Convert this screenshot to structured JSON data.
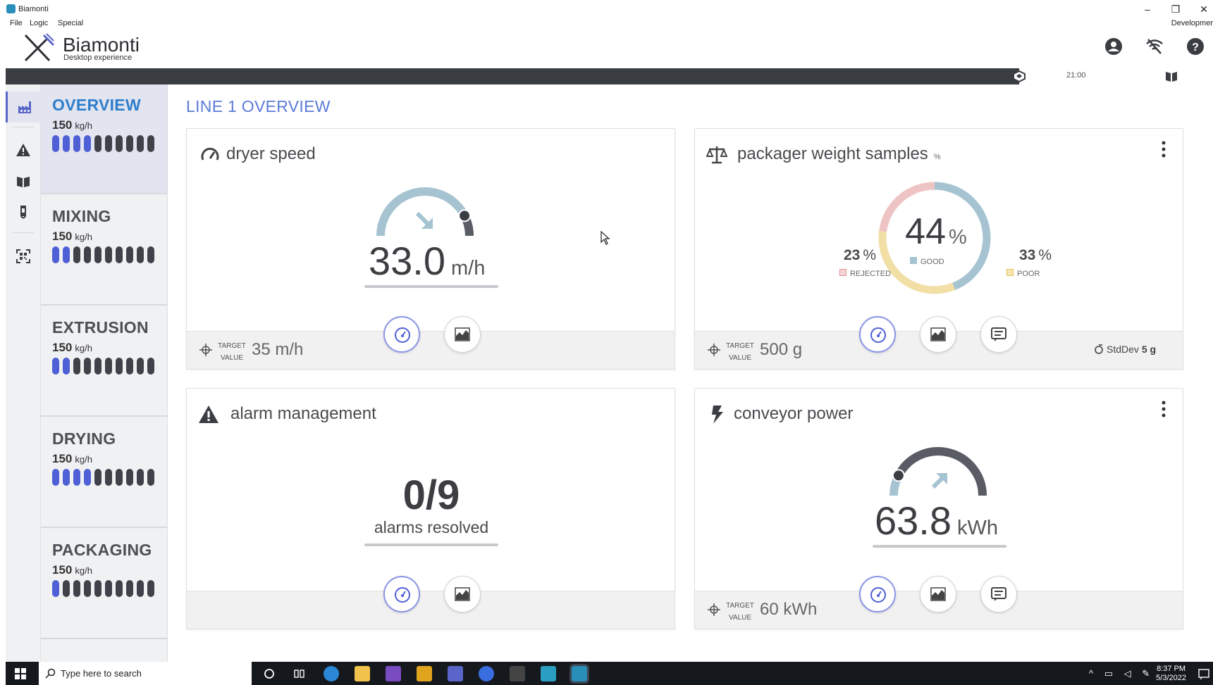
{
  "window": {
    "title": "Biamonti",
    "minimize": "–",
    "restore": "❐",
    "close": "✕"
  },
  "menu": {
    "items": [
      "File",
      "Logic",
      "Special"
    ],
    "right": "Developmer"
  },
  "brand": {
    "name": "Biamonti",
    "subtitle": "Desktop experience"
  },
  "header_icons": [
    "account-icon",
    "wifi-off-icon",
    "help-icon"
  ],
  "timeline": {
    "time": "21:00"
  },
  "rail_icons": [
    "factory-icon",
    "alert-icon",
    "map-book-icon",
    "test-tube-icon",
    "qr-scan-icon"
  ],
  "sections": [
    {
      "name": "OVERVIEW",
      "value": "150",
      "unit": "kg/h",
      "active_bars": 4,
      "total_bars": 10
    },
    {
      "name": "MIXING",
      "value": "150",
      "unit": "kg/h",
      "active_bars": 2,
      "total_bars": 10
    },
    {
      "name": "EXTRUSION",
      "value": "150",
      "unit": "kg/h",
      "active_bars": 2,
      "total_bars": 10
    },
    {
      "name": "DRYING",
      "value": "150",
      "unit": "kg/h",
      "active_bars": 4,
      "total_bars": 10
    },
    {
      "name": "PACKAGING",
      "value": "150",
      "unit": "kg/h",
      "active_bars": 1,
      "total_bars": 10
    }
  ],
  "main": {
    "title": "LINE 1 OVERVIEW"
  },
  "cards": {
    "dryer": {
      "title": "dryer speed",
      "value": "33.0",
      "unit": "m/h",
      "gauge_fraction": 0.85,
      "target_label": "TARGET VALUE",
      "target_value": "35 m/h",
      "trend": "down"
    },
    "packager": {
      "title": "packager weight samples",
      "title_unit": "%",
      "good": {
        "value": "44",
        "unit": "%",
        "label": "GOOD",
        "color": "#a6c3d1"
      },
      "rejected": {
        "value": "23",
        "unit": "%",
        "label": "REJECTED",
        "color": "#eec3c3"
      },
      "poor": {
        "value": "33",
        "unit": "%",
        "label": "POOR",
        "color": "#f2dfa5"
      },
      "target_label": "TARGET VALUE",
      "target_value": "500 g",
      "stddev_label": "StdDev",
      "stddev_value": "5 g"
    },
    "alarm": {
      "title": "alarm management",
      "value": "0/9",
      "caption": "alarms resolved"
    },
    "conveyor": {
      "title": "conveyor power",
      "value": "63.8",
      "unit": "kWh",
      "gauge_fraction": 0.15,
      "target_label": "TARGET VALUE",
      "target_value": "60 kWh",
      "trend": "up"
    }
  },
  "taskbar": {
    "search_placeholder": "Type here to search",
    "time": "8:37 PM",
    "date": "5/3/2022"
  },
  "colors": {
    "accent": "#5965c9",
    "title_blue": "#5b7bd5",
    "bar_on": "#4f5fd6",
    "dark": "#3f4249"
  }
}
